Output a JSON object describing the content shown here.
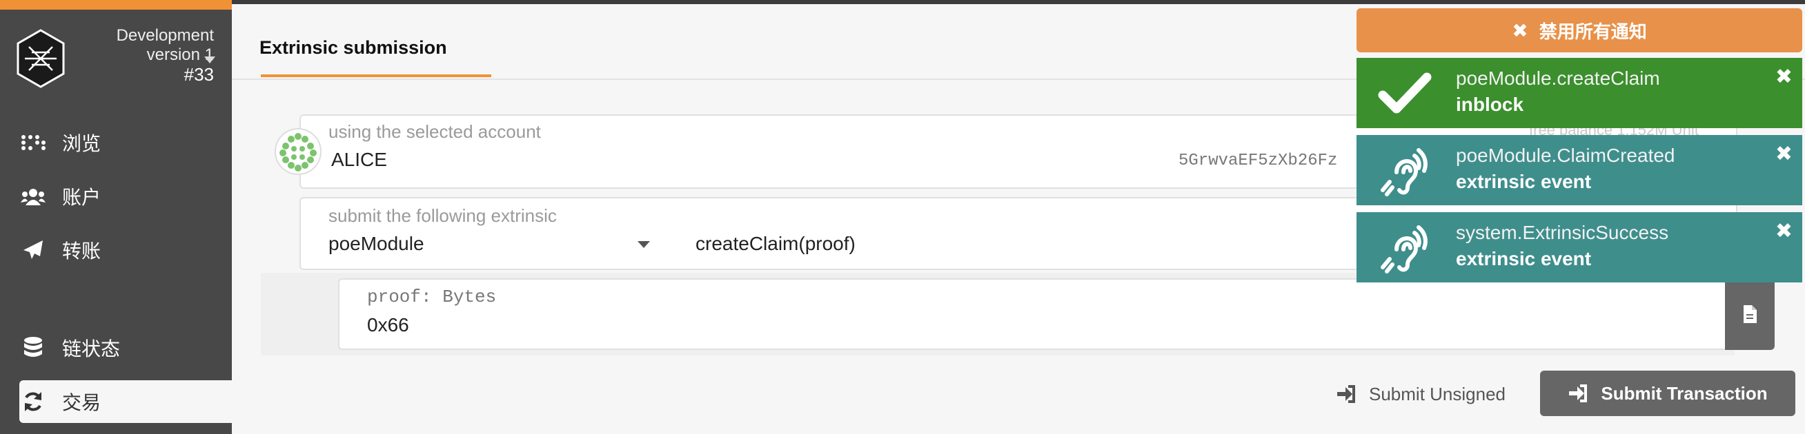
{
  "sidebar": {
    "chain_name": "Development",
    "version": "version 1",
    "block": "#33",
    "items": [
      {
        "label": "浏览",
        "icon": "braille-icon"
      },
      {
        "label": "账户",
        "icon": "users-icon"
      },
      {
        "label": "转账",
        "icon": "paper-plane-icon"
      },
      {
        "label": "链状态",
        "icon": "database-icon"
      },
      {
        "label": "交易",
        "icon": "sync-icon"
      }
    ]
  },
  "tabs": [
    {
      "label": "Extrinsic submission"
    }
  ],
  "account": {
    "label": "using the selected account",
    "name": "ALICE",
    "address": "5GrwvaEF5zXb26Fz",
    "balance_partial": "free balance 1.152M Unit"
  },
  "extrinsic": {
    "label": "submit the following extrinsic",
    "module": "poeModule",
    "call": "createClaim(proof)",
    "ghost_right": "eClaim"
  },
  "param": {
    "label": "proof: Bytes",
    "value": "0x66"
  },
  "buttons": {
    "submit_unsigned": "Submit Unsigned",
    "submit_transaction": "Submit Transaction"
  },
  "notifications": {
    "dismiss_all": "禁用所有通知",
    "items": [
      {
        "title": "poeModule.createClaim",
        "status": "inblock",
        "color": "#3b8f2d",
        "icon": "check-icon"
      },
      {
        "title": "poeModule.ClaimCreated",
        "status": "extrinsic event",
        "color": "#3e8e8c",
        "icon": "assistive-listening-icon"
      },
      {
        "title": "system.ExtrinsicSuccess",
        "status": "extrinsic event",
        "color": "#3e8e8c",
        "icon": "assistive-listening-icon"
      }
    ]
  },
  "colors": {
    "accent": "#f19135",
    "sidebar_bg": "#484848"
  }
}
